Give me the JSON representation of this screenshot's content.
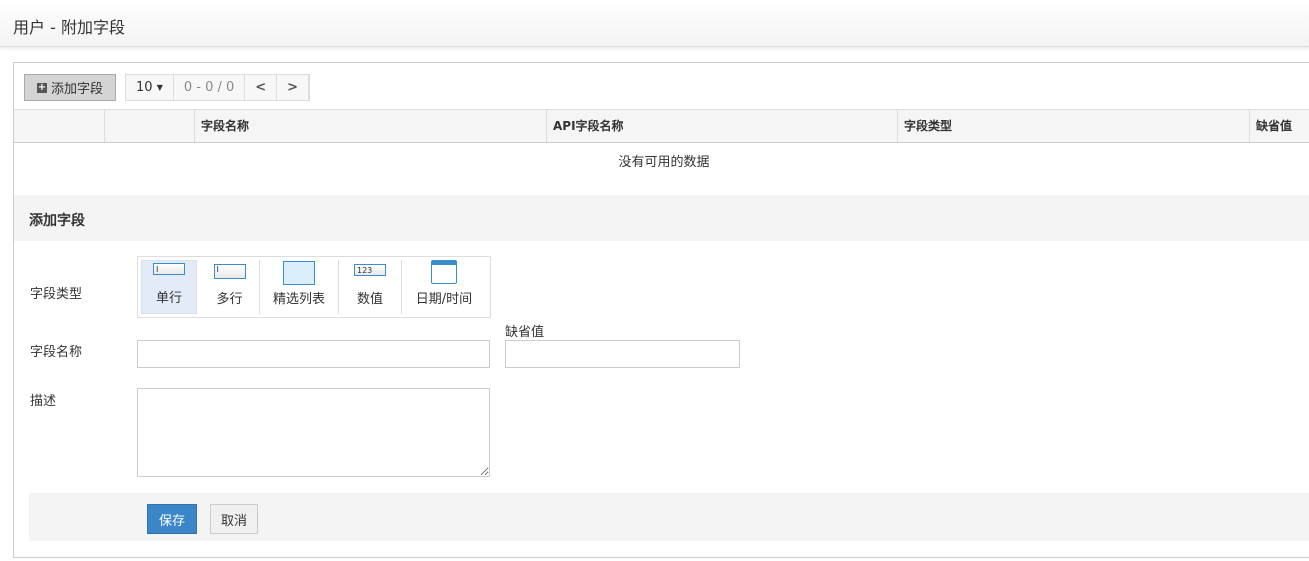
{
  "header": {
    "title": "用户 - 附加字段"
  },
  "toolbar": {
    "add_label": "添加字段",
    "page_size": "10",
    "range": "0 - 0 / 0"
  },
  "table": {
    "columns": [
      "字段名称",
      "API字段名称",
      "字段类型",
      "缺省值"
    ],
    "empty_text": "没有可用的数据"
  },
  "form": {
    "section_title": "添加字段",
    "type_label": "字段类型",
    "types": [
      {
        "label": "单行",
        "selected": true
      },
      {
        "label": "多行"
      },
      {
        "label": "精选列表"
      },
      {
        "label": "数值"
      },
      {
        "label": "日期/时间"
      }
    ],
    "name_label": "字段名称",
    "name_value": "",
    "default_label": "缺省值",
    "default_value": "",
    "desc_label": "描述",
    "desc_value": "",
    "save_label": "保存",
    "cancel_label": "取消"
  }
}
